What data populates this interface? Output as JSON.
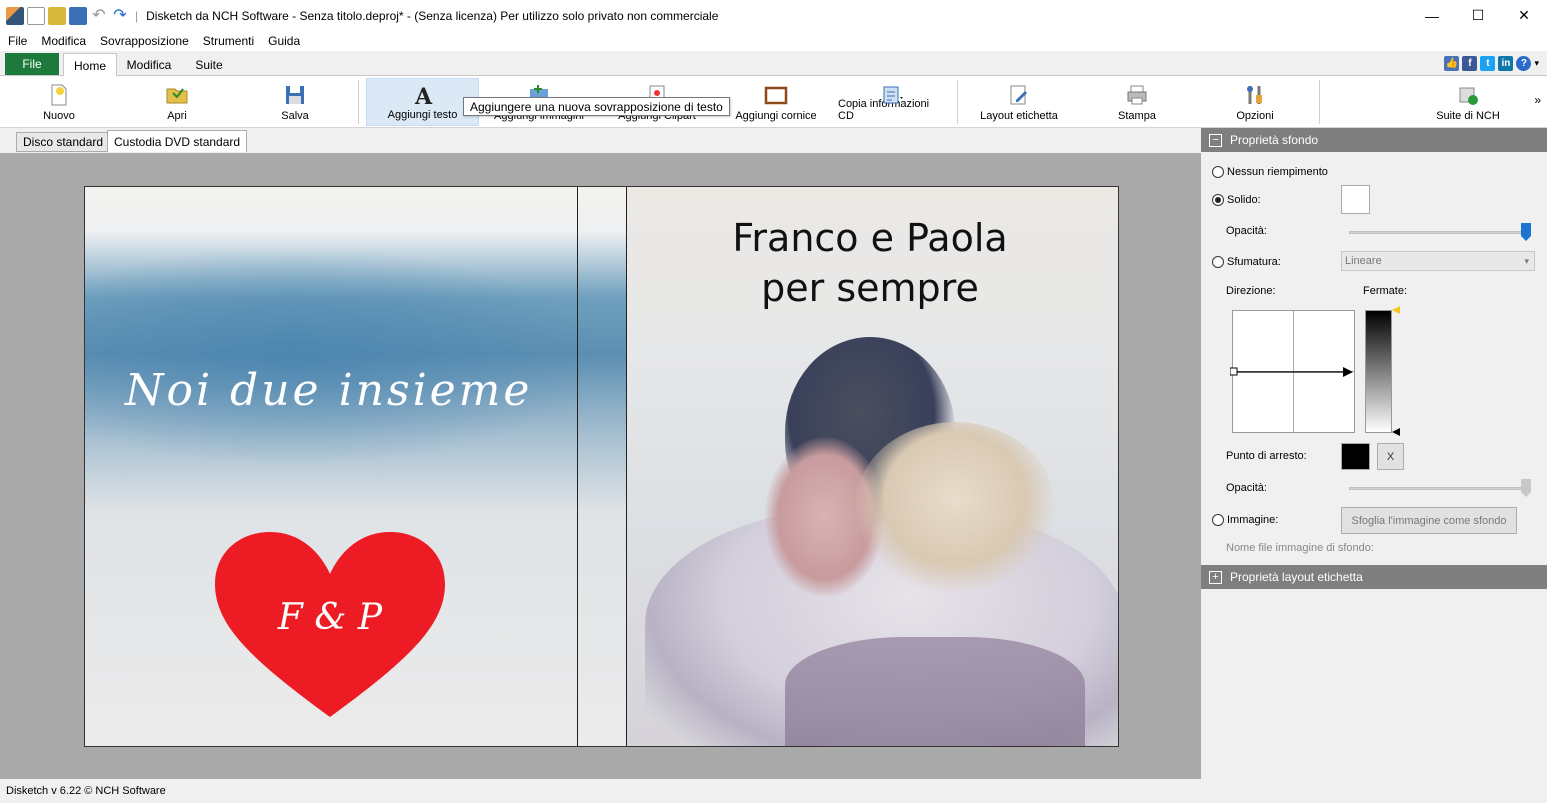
{
  "window": {
    "title": "Disketch da NCH Software - Senza titolo.deproj* - (Senza licenza) Per utilizzo solo privato non commerciale",
    "controls": [
      "—",
      "☐",
      "✕"
    ]
  },
  "menu": [
    "File",
    "Modifica",
    "Sovrapposizione",
    "Strumenti",
    "Guida"
  ],
  "ribbon_tabs": {
    "file": "File",
    "home": "Home",
    "modifica": "Modifica",
    "suite": "Suite"
  },
  "toolbar": {
    "nuovo": "Nuovo",
    "apri": "Apri",
    "salva": "Salva",
    "aggiungi_testo": "Aggiungi testo",
    "aggiungi_immagini": "Aggiungi immagini",
    "aggiungi_clipart": "Aggiungi Clipart",
    "aggiungi_cornice": "Aggiungi cornice",
    "copia_info_cd": "Copia informazioni CD",
    "layout_etichetta": "Layout etichetta",
    "stampa": "Stampa",
    "opzioni": "Opzioni",
    "suite_nch": "Suite di NCH",
    "more": "»"
  },
  "tooltip": "Aggiungere una nuova sovrapposizione di testo",
  "doc_tabs": [
    "Disco standard",
    "Custodia DVD standard"
  ],
  "cover": {
    "left_text": "Noi due insieme",
    "right_title_line1": "Franco e Paola",
    "right_title_line2": "per sempre",
    "heart_text": "F & P",
    "heart_color": "#ed1c24"
  },
  "panel": {
    "background_header": "Proprietà sfondo",
    "no_fill": "Nessun riempimento",
    "solid": "Solido:",
    "opacity": "Opacità:",
    "gradient": "Sfumatura:",
    "gradient_type": "Lineare",
    "direction": "Direzione:",
    "stops": "Fermate:",
    "stop_point": "Punto di arresto:",
    "stop_remove": "X",
    "opacity2": "Opacità:",
    "image": "Immagine:",
    "browse_button": "Sfoglia l'immagine come sfondo",
    "image_filename_label": "Nome file immagine di sfondo:",
    "layout_header": "Proprietà layout etichetta",
    "selected_fill": "solid",
    "solid_color": "#ffffff",
    "stop_color": "#000000",
    "opacity_value": 1.0
  },
  "status": "Disketch v 6.22 © NCH Software"
}
